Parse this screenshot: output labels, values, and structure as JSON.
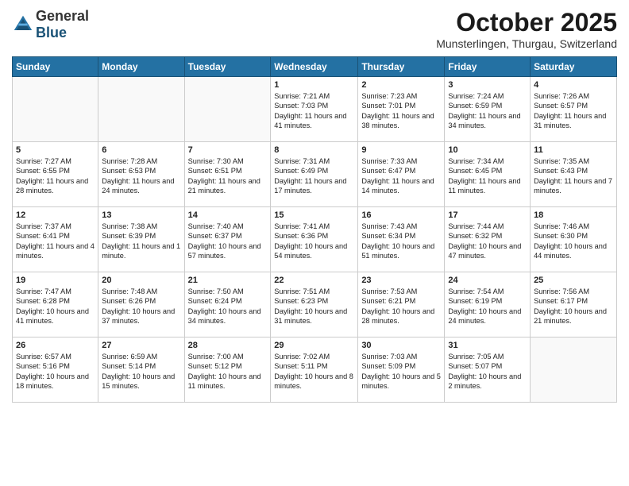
{
  "header": {
    "logo_general": "General",
    "logo_blue": "Blue",
    "month_year": "October 2025",
    "location": "Munsterlingen, Thurgau, Switzerland"
  },
  "days_of_week": [
    "Sunday",
    "Monday",
    "Tuesday",
    "Wednesday",
    "Thursday",
    "Friday",
    "Saturday"
  ],
  "weeks": [
    [
      {
        "day": "",
        "info": ""
      },
      {
        "day": "",
        "info": ""
      },
      {
        "day": "",
        "info": ""
      },
      {
        "day": "1",
        "info": "Sunrise: 7:21 AM\nSunset: 7:03 PM\nDaylight: 11 hours and 41 minutes."
      },
      {
        "day": "2",
        "info": "Sunrise: 7:23 AM\nSunset: 7:01 PM\nDaylight: 11 hours and 38 minutes."
      },
      {
        "day": "3",
        "info": "Sunrise: 7:24 AM\nSunset: 6:59 PM\nDaylight: 11 hours and 34 minutes."
      },
      {
        "day": "4",
        "info": "Sunrise: 7:26 AM\nSunset: 6:57 PM\nDaylight: 11 hours and 31 minutes."
      }
    ],
    [
      {
        "day": "5",
        "info": "Sunrise: 7:27 AM\nSunset: 6:55 PM\nDaylight: 11 hours and 28 minutes."
      },
      {
        "day": "6",
        "info": "Sunrise: 7:28 AM\nSunset: 6:53 PM\nDaylight: 11 hours and 24 minutes."
      },
      {
        "day": "7",
        "info": "Sunrise: 7:30 AM\nSunset: 6:51 PM\nDaylight: 11 hours and 21 minutes."
      },
      {
        "day": "8",
        "info": "Sunrise: 7:31 AM\nSunset: 6:49 PM\nDaylight: 11 hours and 17 minutes."
      },
      {
        "day": "9",
        "info": "Sunrise: 7:33 AM\nSunset: 6:47 PM\nDaylight: 11 hours and 14 minutes."
      },
      {
        "day": "10",
        "info": "Sunrise: 7:34 AM\nSunset: 6:45 PM\nDaylight: 11 hours and 11 minutes."
      },
      {
        "day": "11",
        "info": "Sunrise: 7:35 AM\nSunset: 6:43 PM\nDaylight: 11 hours and 7 minutes."
      }
    ],
    [
      {
        "day": "12",
        "info": "Sunrise: 7:37 AM\nSunset: 6:41 PM\nDaylight: 11 hours and 4 minutes."
      },
      {
        "day": "13",
        "info": "Sunrise: 7:38 AM\nSunset: 6:39 PM\nDaylight: 11 hours and 1 minute."
      },
      {
        "day": "14",
        "info": "Sunrise: 7:40 AM\nSunset: 6:37 PM\nDaylight: 10 hours and 57 minutes."
      },
      {
        "day": "15",
        "info": "Sunrise: 7:41 AM\nSunset: 6:36 PM\nDaylight: 10 hours and 54 minutes."
      },
      {
        "day": "16",
        "info": "Sunrise: 7:43 AM\nSunset: 6:34 PM\nDaylight: 10 hours and 51 minutes."
      },
      {
        "day": "17",
        "info": "Sunrise: 7:44 AM\nSunset: 6:32 PM\nDaylight: 10 hours and 47 minutes."
      },
      {
        "day": "18",
        "info": "Sunrise: 7:46 AM\nSunset: 6:30 PM\nDaylight: 10 hours and 44 minutes."
      }
    ],
    [
      {
        "day": "19",
        "info": "Sunrise: 7:47 AM\nSunset: 6:28 PM\nDaylight: 10 hours and 41 minutes."
      },
      {
        "day": "20",
        "info": "Sunrise: 7:48 AM\nSunset: 6:26 PM\nDaylight: 10 hours and 37 minutes."
      },
      {
        "day": "21",
        "info": "Sunrise: 7:50 AM\nSunset: 6:24 PM\nDaylight: 10 hours and 34 minutes."
      },
      {
        "day": "22",
        "info": "Sunrise: 7:51 AM\nSunset: 6:23 PM\nDaylight: 10 hours and 31 minutes."
      },
      {
        "day": "23",
        "info": "Sunrise: 7:53 AM\nSunset: 6:21 PM\nDaylight: 10 hours and 28 minutes."
      },
      {
        "day": "24",
        "info": "Sunrise: 7:54 AM\nSunset: 6:19 PM\nDaylight: 10 hours and 24 minutes."
      },
      {
        "day": "25",
        "info": "Sunrise: 7:56 AM\nSunset: 6:17 PM\nDaylight: 10 hours and 21 minutes."
      }
    ],
    [
      {
        "day": "26",
        "info": "Sunrise: 6:57 AM\nSunset: 5:16 PM\nDaylight: 10 hours and 18 minutes."
      },
      {
        "day": "27",
        "info": "Sunrise: 6:59 AM\nSunset: 5:14 PM\nDaylight: 10 hours and 15 minutes."
      },
      {
        "day": "28",
        "info": "Sunrise: 7:00 AM\nSunset: 5:12 PM\nDaylight: 10 hours and 11 minutes."
      },
      {
        "day": "29",
        "info": "Sunrise: 7:02 AM\nSunset: 5:11 PM\nDaylight: 10 hours and 8 minutes."
      },
      {
        "day": "30",
        "info": "Sunrise: 7:03 AM\nSunset: 5:09 PM\nDaylight: 10 hours and 5 minutes."
      },
      {
        "day": "31",
        "info": "Sunrise: 7:05 AM\nSunset: 5:07 PM\nDaylight: 10 hours and 2 minutes."
      },
      {
        "day": "",
        "info": ""
      }
    ]
  ]
}
